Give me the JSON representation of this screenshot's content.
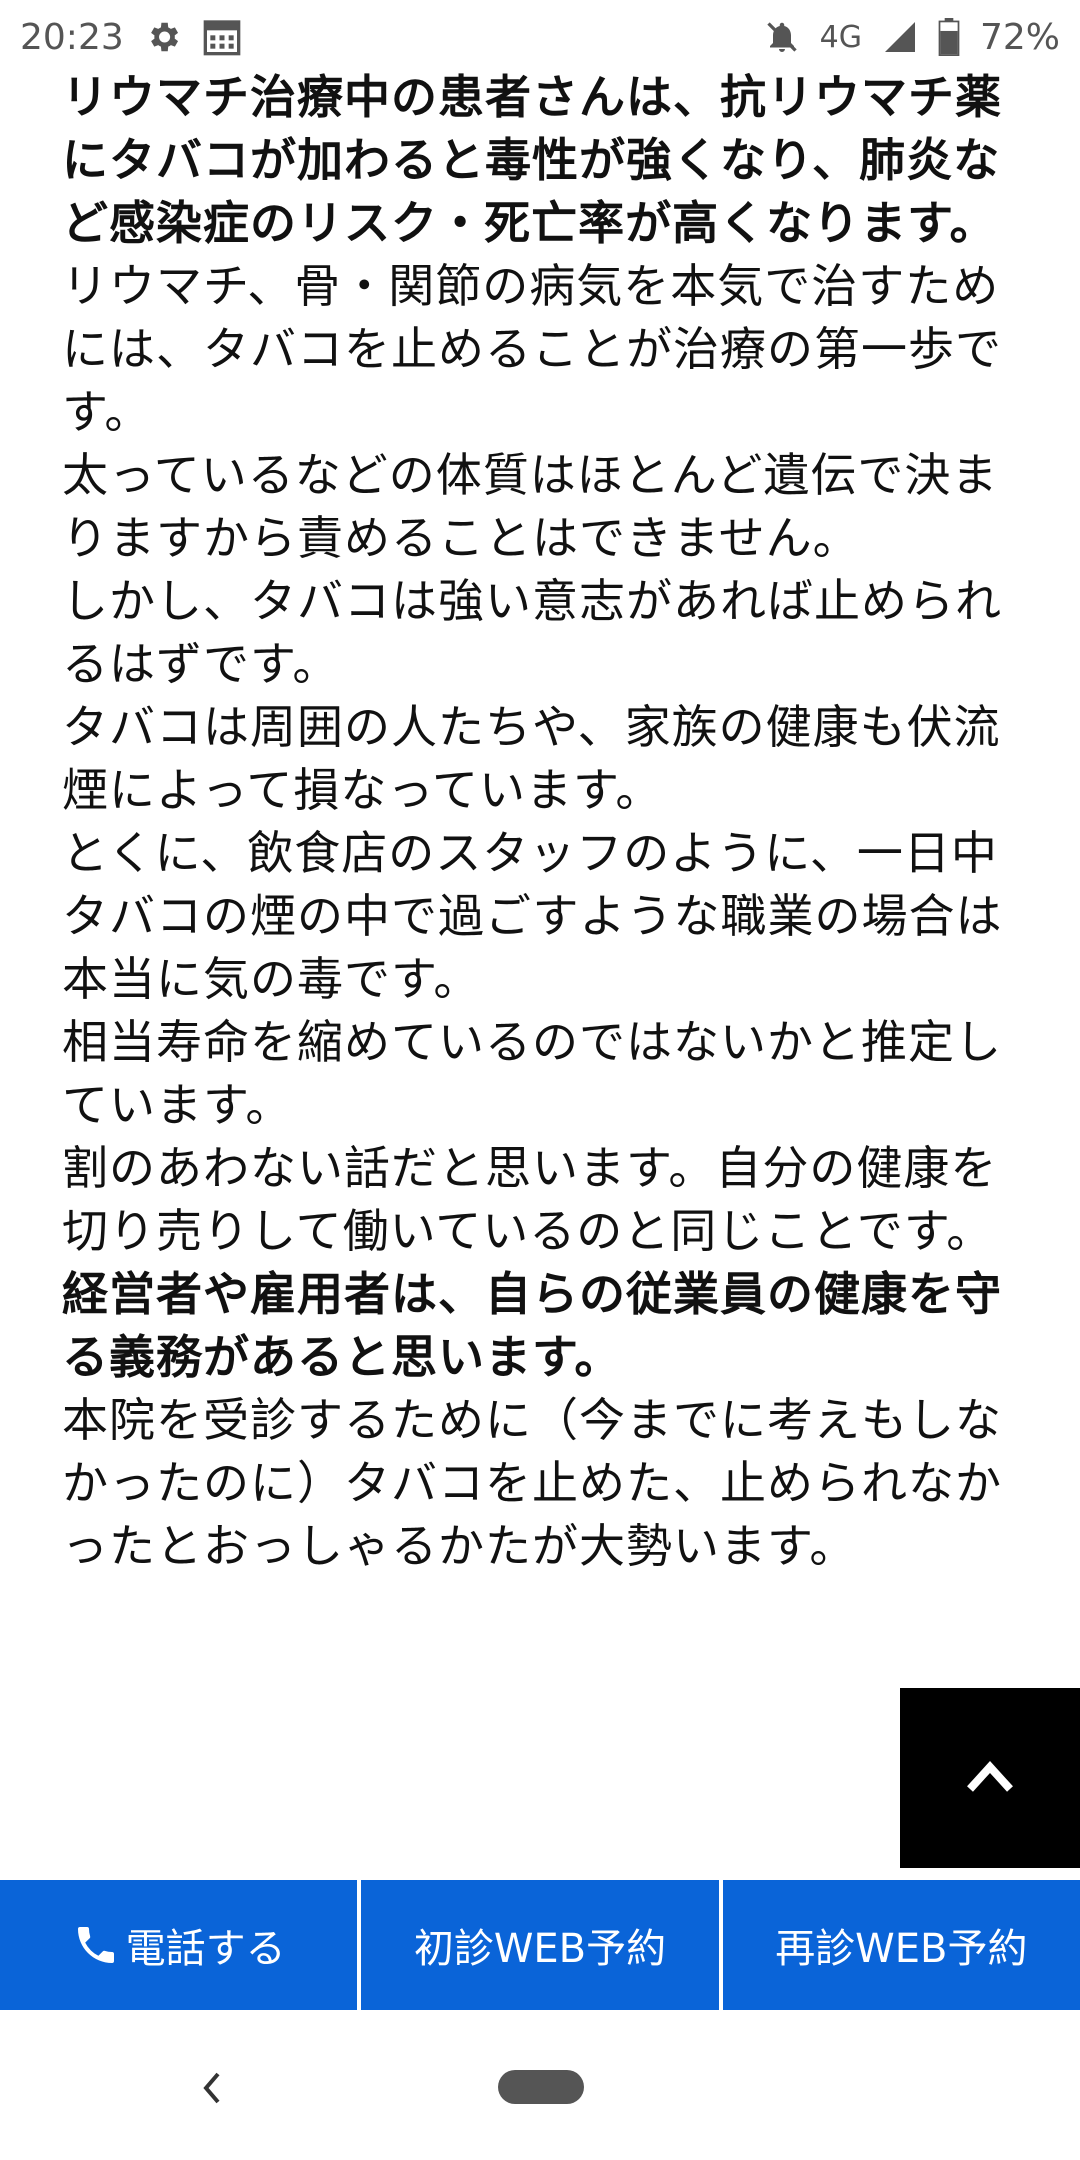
{
  "status_bar": {
    "time": "20:23",
    "network": "4G",
    "battery": "72%",
    "icons": [
      "settings-icon",
      "calendar-icon",
      "mute-bell-icon",
      "signal-icon",
      "battery-icon"
    ]
  },
  "article": {
    "paragraphs": [
      {
        "text": "リウマチ治療中の患者さんは、抗リウマチ薬にタバコが加わると毒性が強くなり、肺炎など感染症のリスク・死亡率が高くなります。",
        "bold": true
      },
      {
        "text": "リウマチ、骨・関節の病気を本気で治すためには、タバコを止めることが治療の第一歩です。",
        "bold": false
      },
      {
        "text": "太っているなどの体質はほとんど遺伝で決まりますから責めることはできません。",
        "bold": false
      },
      {
        "text": "しかし、タバコは強い意志があれば止められるはずです。",
        "bold": false
      },
      {
        "text": "タバコは周囲の人たちや、家族の健康も伏流煙によって損なっています。",
        "bold": false
      },
      {
        "text": "とくに、飲食店のスタッフのように、一日中タバコの煙の中で過ごすような職業の場合は本当に気の毒です。",
        "bold": false
      },
      {
        "text": "相当寿命を縮めているのではないかと推定しています。",
        "bold": false
      },
      {
        "text": "割のあわない話だと思います。自分の健康を切り売りして働いているのと同じことです。",
        "bold": false
      },
      {
        "text": "経営者や雇用者は、自らの従業員の健康を守る義務があると思います。",
        "bold": true
      },
      {
        "text": "本院を受診するために（今までに考えもしなかったのに）タバコを止めた、止められなかったとおっしゃるかたが大勢います。",
        "bold": false
      }
    ]
  },
  "scroll_top": {
    "icon": "chevron-up-icon"
  },
  "action_bar": {
    "call_label": "電話する",
    "first_visit_label": "初診WEB予約",
    "revisit_label": "再診WEB予約",
    "accent_color": "#0a64d8"
  },
  "nav_bar": {
    "back_icon": "back-chevron-icon",
    "home_icon": "home-pill-icon"
  }
}
